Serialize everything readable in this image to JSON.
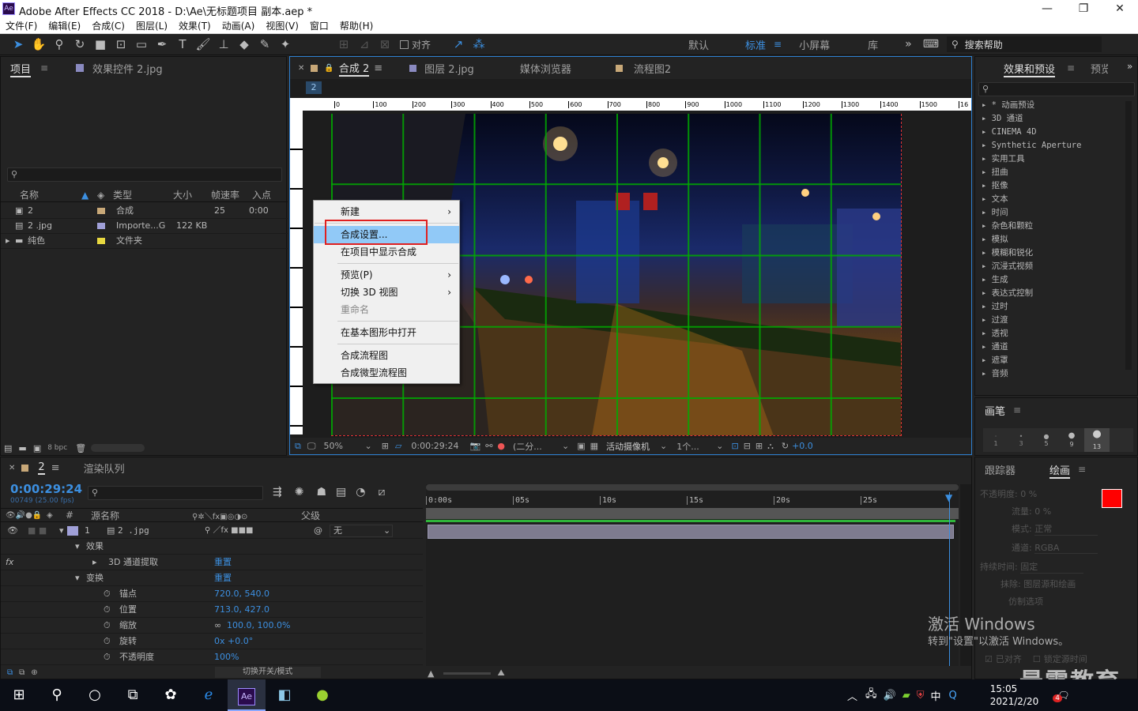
{
  "app_title": "Adobe After Effects CC 2018 - D:\\Ae\\无标题项目 副本.aep *",
  "app_icon": "Ae",
  "window_controls": [
    "—",
    "❐",
    "✕"
  ],
  "menu": [
    "文件(F)",
    "编辑(E)",
    "合成(C)",
    "图层(L)",
    "效果(T)",
    "动画(A)",
    "视图(V)",
    "窗口",
    "帮助(H)"
  ],
  "toolbar": {
    "align_label": "对齐",
    "workspaces": [
      "默认",
      "标准",
      "小屏幕",
      "库"
    ],
    "active_workspace": "标准",
    "search_help": "搜索帮助"
  },
  "project_panel": {
    "tabs": [
      "项目",
      "效果控件 2.jpg"
    ],
    "columns": [
      "名称",
      "类型",
      "大小",
      "帧速率",
      "入点"
    ],
    "items": [
      {
        "name": "2",
        "type": "合成",
        "size": "",
        "fps": "25",
        "in": "0:00"
      },
      {
        "name": "2 .jpg",
        "type": "Importe...G",
        "size": "122 KB",
        "fps": "",
        "in": ""
      },
      {
        "name": "纯色",
        "type": "文件夹",
        "size": "",
        "fps": "",
        "in": ""
      }
    ],
    "bpc": "8 bpc"
  },
  "comp_panel": {
    "tabs": [
      "合成 2",
      "图层 2.jpg",
      "媒体浏览器",
      "流程图2"
    ],
    "sub_tab": "2",
    "ruler_marks": [
      "0",
      "100",
      "200",
      "300",
      "400",
      "500",
      "600",
      "700",
      "800",
      "900",
      "1000",
      "1100",
      "1200",
      "1300",
      "1400",
      "1500",
      "16"
    ],
    "zoom": "50%",
    "timecode": "0:00:29:24",
    "resolution": "(二分...",
    "camera": "活动摄像机",
    "views": "1个...",
    "exposure": "+0.0"
  },
  "context_menu": {
    "items": [
      {
        "label": "新建",
        "sub": true
      },
      {
        "label": "合成设置...",
        "highlight": true
      },
      {
        "label": "在项目中显示合成"
      },
      {
        "sep": true
      },
      {
        "label": "预览(P)",
        "sub": true
      },
      {
        "label": "切换 3D 视图",
        "sub": true
      },
      {
        "label": "重命名",
        "disabled": true
      },
      {
        "sep": true
      },
      {
        "label": "在基本图形中打开"
      },
      {
        "sep": true
      },
      {
        "label": "合成流程图"
      },
      {
        "label": "合成微型流程图"
      }
    ]
  },
  "effects_panel": {
    "tabs": [
      "效果和预设",
      "预览"
    ],
    "items": [
      "* 动画预设",
      "3D 通道",
      "CINEMA 4D",
      "Synthetic Aperture",
      "实用工具",
      "扭曲",
      "抠像",
      "文本",
      "时间",
      "杂色和颗粒",
      "模拟",
      "模糊和锐化",
      "沉浸式视频",
      "生成",
      "表达式控制",
      "过时",
      "过渡",
      "透视",
      "通道",
      "遮罩",
      "音频"
    ]
  },
  "brush_panel": {
    "title": "画笔",
    "sizes": [
      "1",
      "3",
      "5",
      "9",
      "13"
    ]
  },
  "paint_panel": {
    "tabs": [
      "跟踪器",
      "绘画"
    ],
    "fields": [
      {
        "label": "不透明度:",
        "value": "0 %"
      },
      {
        "label": "流量:",
        "value": "0 %"
      },
      {
        "label": "模式:",
        "value": "正常"
      },
      {
        "label": "通道:",
        "value": "RGBA"
      },
      {
        "label": "持续时间:",
        "value": "固定"
      },
      {
        "label": "抹除:",
        "value": "图层源和绘画"
      },
      {
        "label": "仿制选项",
        "value": ""
      }
    ],
    "checks": [
      "已对齐",
      "锁定源时间"
    ],
    "swatch": "#ff0000"
  },
  "timeline": {
    "tabs": [
      "2",
      "渲染队列"
    ],
    "timecode": "0:00:29:24",
    "frames": "00749 (25.00 fps)",
    "columns": {
      "num": "#",
      "source": "源名称",
      "parent": "父级"
    },
    "time_marks": [
      "0:00s",
      "05s",
      "10s",
      "15s",
      "20s",
      "25s"
    ],
    "layer": {
      "num": "1",
      "name": "2 .jpg",
      "parent": "无"
    },
    "props": [
      {
        "name": "效果",
        "level": 1,
        "value": ""
      },
      {
        "name": "3D 通道提取",
        "level": 2,
        "value": "重置"
      },
      {
        "name": "变换",
        "level": 1,
        "value": "重置"
      },
      {
        "name": "锚点",
        "level": 3,
        "value": "720.0, 540.0"
      },
      {
        "name": "位置",
        "level": 3,
        "value": "713.0, 427.0"
      },
      {
        "name": "缩放",
        "level": 3,
        "value": "100.0, 100.0%"
      },
      {
        "name": "旋转",
        "level": 3,
        "value": "0x +0.0°"
      },
      {
        "name": "不透明度",
        "level": 3,
        "value": "100%"
      }
    ],
    "switch_label": "切换开关/模式"
  },
  "watermark": {
    "line1": "激活 Windows",
    "line2": "转到\"设置\"以激活 Windows。",
    "brand": "最需教育"
  },
  "taskbar": {
    "time": "15:05",
    "date": "2021/2/20",
    "ime": "中",
    "badge": "4"
  }
}
